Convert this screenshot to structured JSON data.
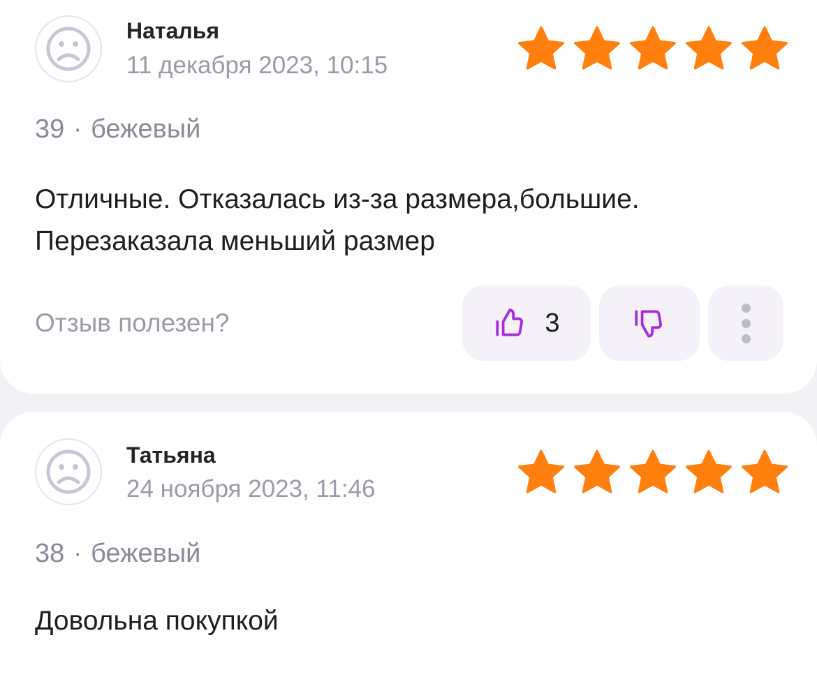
{
  "colors": {
    "star": "#ff7f0f",
    "accent": "#a72bdc",
    "muted_text": "#9c9aa8",
    "background": "#f2f2f6"
  },
  "reviews": [
    {
      "author": "Наталья",
      "date": "11 декабря 2023, 10:15",
      "rating": 5,
      "size": "39",
      "separator": "·",
      "color": "бежевый",
      "text_lines": [
        "Отличные. Отказалась из-за размера,большие.",
        "Перезаказала меньший размер"
      ],
      "helpful_label": "Отзыв полезен?",
      "likes": "3",
      "icons": {
        "avatar": "sad-face-avatar-icon",
        "like": "thumbs-up-icon",
        "dislike": "thumbs-down-icon",
        "more": "more-vertical-icon"
      }
    },
    {
      "author": "Татьяна",
      "date": "24 ноября 2023, 11:46",
      "rating": 5,
      "size": "38",
      "separator": "·",
      "color": "бежевый",
      "text_lines": [
        "Довольна покупкой"
      ],
      "icons": {
        "avatar": "sad-face-avatar-icon"
      }
    }
  ]
}
